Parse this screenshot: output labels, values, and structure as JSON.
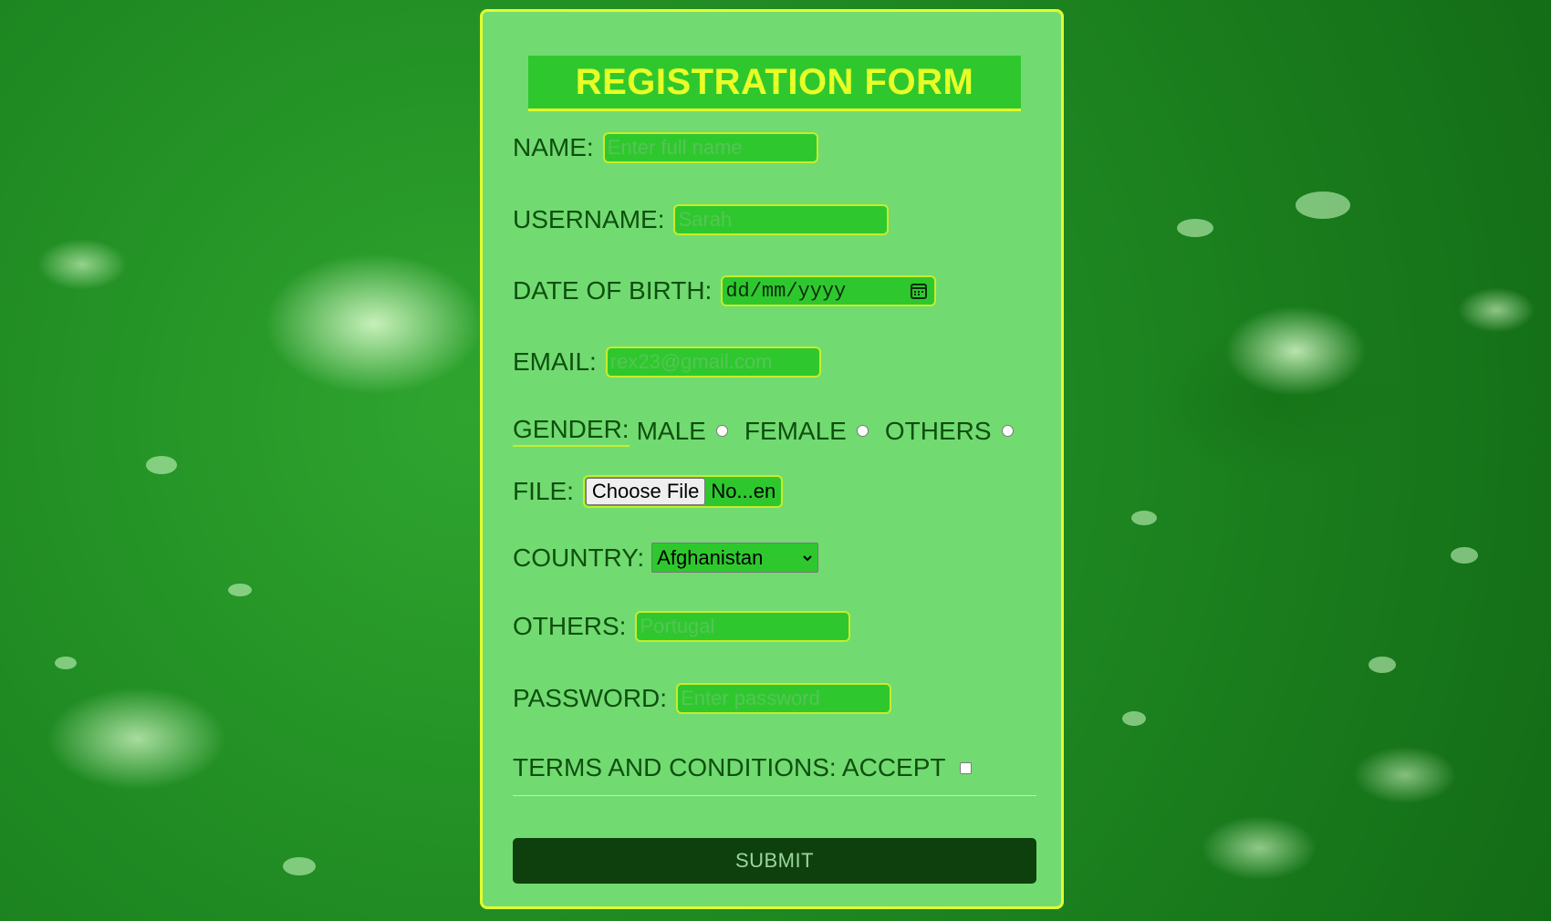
{
  "form": {
    "title": "REGISTRATION FORM",
    "name": {
      "label": "NAME:",
      "placeholder": "Enter full name"
    },
    "username": {
      "label": "USERNAME:",
      "placeholder": "Sarah"
    },
    "dob": {
      "label": "DATE OF BIRTH:",
      "value": "dd/mm/yyyy"
    },
    "email": {
      "label": "EMAIL:",
      "placeholder": "rex23@gmail.com"
    },
    "gender": {
      "label": "GENDER:",
      "options": [
        "MALE",
        "FEMALE",
        "OTHERS"
      ]
    },
    "file": {
      "label": "FILE:",
      "button": "Choose File",
      "status": "No...en"
    },
    "country": {
      "label": "COUNTRY:",
      "selected": "Afghanistan"
    },
    "others": {
      "label": "OTHERS:",
      "placeholder": "Portugal"
    },
    "password": {
      "label": "PASSWORD:",
      "placeholder": "Enter password"
    },
    "terms": {
      "label": "TERMS AND CONDITIONS: ACCEPT"
    },
    "submit": "SUBMIT"
  },
  "colors": {
    "card_bg": "#71db71",
    "card_border": "#e3ff2e",
    "title_bg": "#2ec82e",
    "title_text": "#e8ff27",
    "input_bg": "#2ec82e",
    "submit_bg": "#0e400e"
  },
  "icons": {
    "date": "calendar-icon",
    "select": "chevron-down-icon"
  }
}
